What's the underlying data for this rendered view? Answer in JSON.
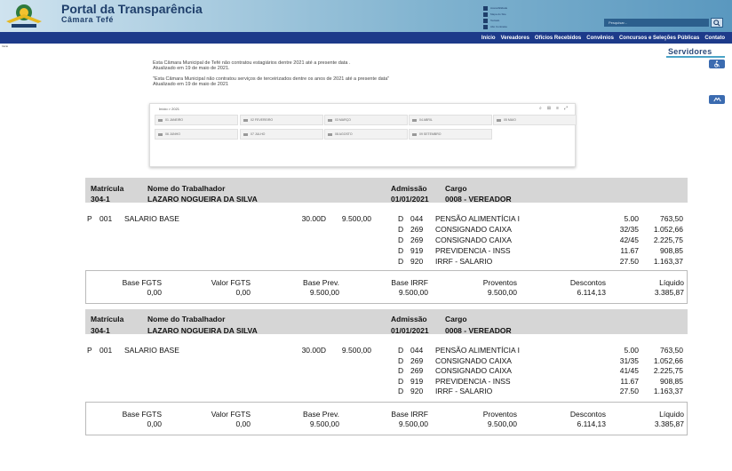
{
  "header": {
    "title": "Portal da Transparência",
    "subtitle": "Câmara Tefé",
    "accessibility_links": [
      "Acessibilidade",
      "Mapa do Site",
      "Teclado",
      "Alto Contraste"
    ],
    "search_placeholder": "Pesquisar..."
  },
  "breadcrumb": "Início",
  "nav": [
    "Início",
    "Vereadores",
    "Ofícios Recebidos",
    "Convênios",
    "Concursos e Seleções Públicas",
    "Contato"
  ],
  "section": "Servidores",
  "notices": [
    {
      "line1": "Esta Câmara Municipal de Tefé não contratou estagiários dentre 2021 até a presente data .",
      "line2": "Atualizado em 19 de maio de 2021."
    },
    {
      "line1": "\"Esta Câmara Municipal não contratou serviços de terceirizados dentre os anos de 2021 até a presente data\"",
      "line2": "Atualizado em 19 de maio de 2021"
    }
  ],
  "filter": {
    "path": "Início > 2021",
    "tools": [
      "⌕",
      "⊞",
      "≡",
      "⤢"
    ],
    "months": [
      "01 JANEIRO",
      "02 FEVEREIRO",
      "03 MARÇO",
      "04 ABRIL",
      "05 MAIO",
      "06 JUNHO",
      "07 JULHO",
      "08 AGOSTO",
      "09 SETEMBRO"
    ]
  },
  "colors": {
    "navbar": "#1d3a8a",
    "header_band": "#d6d6d6",
    "accent": "#4aa3c7"
  },
  "payslips": [
    {
      "labels": {
        "matricula": "Matrícula",
        "trabalhador": "Nome do Trabalhador",
        "admissao": "Admissão",
        "cargo": "Cargo"
      },
      "matricula": "304-1",
      "nome": "LAZARO NOGUEIRA DA SILVA",
      "admissao": "01/01/2021",
      "cargo": "0008 - VEREADOR",
      "earning": {
        "type": "P",
        "code": "001",
        "desc": "SALARIO BASE",
        "ref": "30.00D",
        "value": "9.500,00"
      },
      "deductions": [
        {
          "type": "D",
          "code": "044",
          "desc": "PENSÃO ALIMENTÍCIA I",
          "ref": "5.00",
          "value": "763,50"
        },
        {
          "type": "D",
          "code": "269",
          "desc": "CONSIGNADO CAIXA",
          "ref": "32/35",
          "value": "1.052,66"
        },
        {
          "type": "D",
          "code": "269",
          "desc": "CONSIGNADO CAIXA",
          "ref": "42/45",
          "value": "2.225,75"
        },
        {
          "type": "D",
          "code": "919",
          "desc": "PREVIDENCIA - INSS",
          "ref": "11.67",
          "value": "908,85"
        },
        {
          "type": "D",
          "code": "920",
          "desc": "IRRF - SALARIO",
          "ref": "27.50",
          "value": "1.163,37"
        }
      ],
      "totals": [
        {
          "label": "Base FGTS",
          "value": "0,00"
        },
        {
          "label": "Valor FGTS",
          "value": "0,00"
        },
        {
          "label": "Base Prev.",
          "value": "9.500,00"
        },
        {
          "label": "Base IRRF",
          "value": "9.500,00"
        },
        {
          "label": "Proventos",
          "value": "9.500,00"
        },
        {
          "label": "Descontos",
          "value": "6.114,13"
        },
        {
          "label": "Líquido",
          "value": "3.385,87"
        }
      ]
    },
    {
      "labels": {
        "matricula": "Matrícula",
        "trabalhador": "Nome do Trabalhador",
        "admissao": "Admissão",
        "cargo": "Cargo"
      },
      "matricula": "304-1",
      "nome": "LAZARO NOGUEIRA DA SILVA",
      "admissao": "01/01/2021",
      "cargo": "0008 - VEREADOR",
      "earning": {
        "type": "P",
        "code": "001",
        "desc": "SALARIO BASE",
        "ref": "30.00D",
        "value": "9.500,00"
      },
      "deductions": [
        {
          "type": "D",
          "code": "044",
          "desc": "PENSÃO ALIMENTÍCIA I",
          "ref": "5.00",
          "value": "763,50"
        },
        {
          "type": "D",
          "code": "269",
          "desc": "CONSIGNADO CAIXA",
          "ref": "31/35",
          "value": "1.052,66"
        },
        {
          "type": "D",
          "code": "269",
          "desc": "CONSIGNADO CAIXA",
          "ref": "41/45",
          "value": "2.225,75"
        },
        {
          "type": "D",
          "code": "919",
          "desc": "PREVIDENCIA - INSS",
          "ref": "11.67",
          "value": "908,85"
        },
        {
          "type": "D",
          "code": "920",
          "desc": "IRRF - SALARIO",
          "ref": "27.50",
          "value": "1.163,37"
        }
      ],
      "totals": [
        {
          "label": "Base FGTS",
          "value": "0,00"
        },
        {
          "label": "Valor FGTS",
          "value": "0,00"
        },
        {
          "label": "Base Prev.",
          "value": "9.500,00"
        },
        {
          "label": "Base IRRF",
          "value": "9.500,00"
        },
        {
          "label": "Proventos",
          "value": "9.500,00"
        },
        {
          "label": "Descontos",
          "value": "6.114,13"
        },
        {
          "label": "Líquido",
          "value": "3.385,87"
        }
      ]
    }
  ]
}
